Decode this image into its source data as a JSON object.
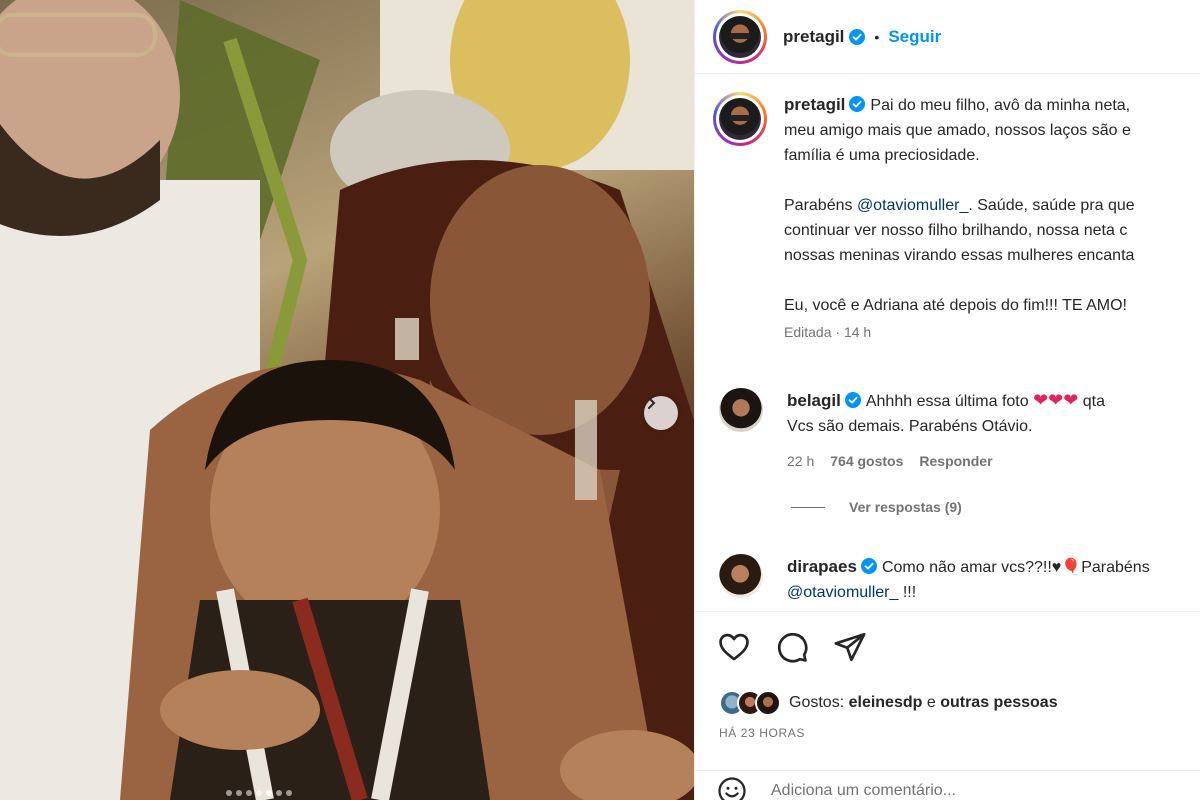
{
  "post": {
    "username": "pretagil",
    "follow_label": "Seguir",
    "caption_lines": [
      "Pai do meu filho, avô da minha neta,",
      "meu amigo mais que amado, nossos laços são e",
      "família é uma preciosidade."
    ],
    "caption_p2_prefix": "Parabéns ",
    "caption_p2_mention": "@otaviomuller_",
    "caption_p2_line1_rest": ". Saúde, saúde pra que",
    "caption_p2_lines": [
      "continuar ver nosso filho brilhando, nossa neta c",
      "nossas meninas virando essas mulheres encanta"
    ],
    "caption_p3": "Eu, você e Adriana até depois do fim!!! TE AMO!",
    "edited_label": "Editada",
    "edited_time": "14 h"
  },
  "comments": [
    {
      "username": "belagil",
      "text_before": "Ahhhh essa última foto ",
      "hearts": "❤❤❤",
      "text_after": " qta",
      "line2": "Vcs são demais. Parabéns Otávio.",
      "time": "22 h",
      "likes": "764 gostos",
      "reply_label": "Responder"
    },
    {
      "username": "dirapaes",
      "text": "Como não amar vcs??!!♥🎈Parabéns",
      "line2_mention": "@otaviomuller_",
      "line2_rest": " !!!"
    }
  ],
  "view_replies_label": "Ver respostas (9)",
  "likes": {
    "prefix": "Gostos: ",
    "user": "eleinesdp",
    "middle": " e ",
    "others": "outras pessoas"
  },
  "time_ago": "HÁ 23 HORAS",
  "add_comment_placeholder": "Adiciona um comentário...",
  "icons": {
    "verified": "verified-badge-icon",
    "like": "heart-icon",
    "comment": "comment-icon",
    "share": "share-icon",
    "emoji": "emoji-icon",
    "next": "chevron-right-icon"
  },
  "colors": {
    "accent": "#0095f6",
    "mention": "#00376b",
    "muted": "#737373",
    "heart": "#e0245e"
  },
  "carousel": {
    "total": 7,
    "active": 5
  }
}
